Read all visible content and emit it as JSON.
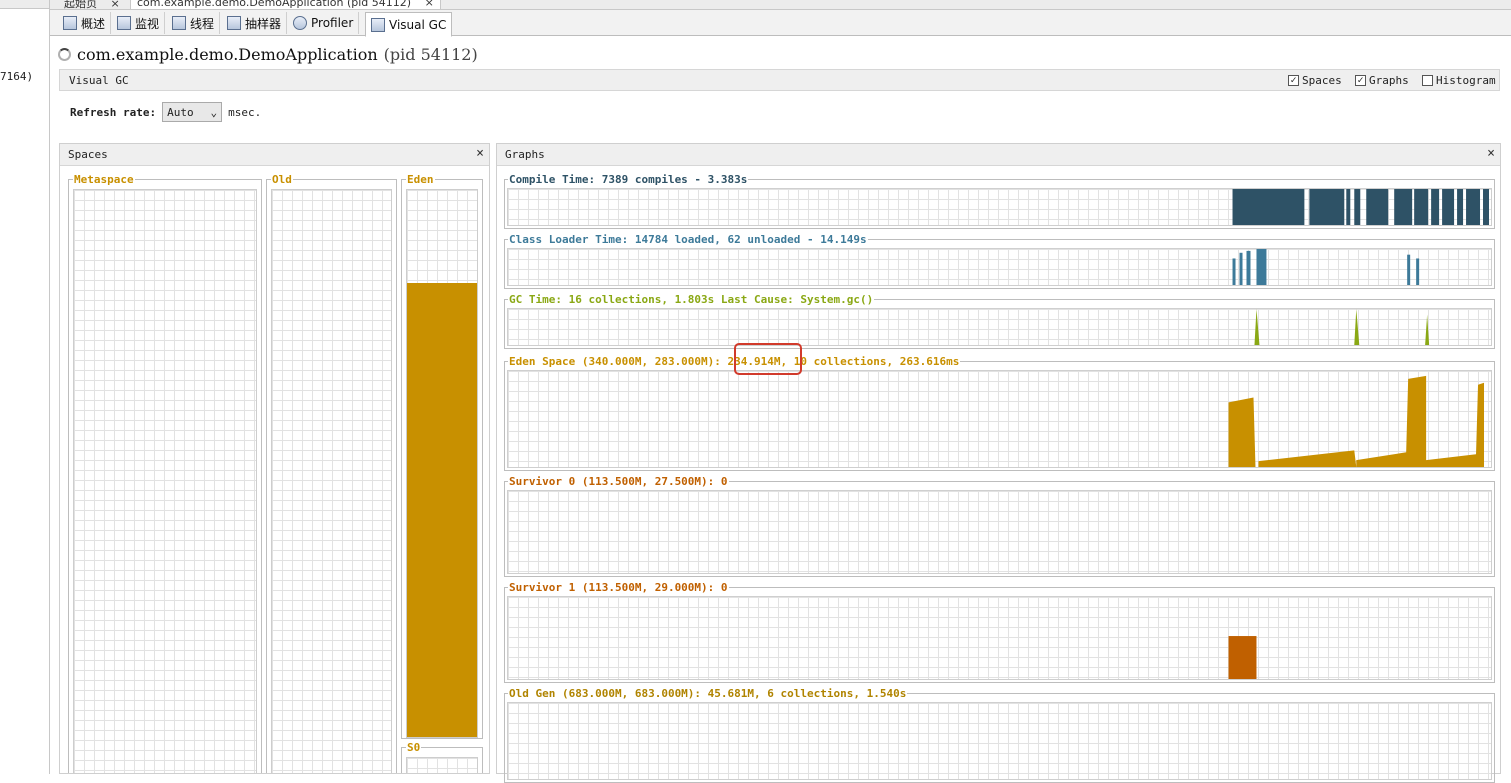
{
  "left_strip": {
    "fragment": "7164)"
  },
  "doc_tabs": [
    {
      "label": "起始页",
      "close": "×"
    },
    {
      "label": "com.example.demo.DemoApplication (pid 54112)",
      "close": "×"
    }
  ],
  "tool_tabs": [
    {
      "label": "概述",
      "icon": "info-icon"
    },
    {
      "label": "监视",
      "icon": "monitor-icon"
    },
    {
      "label": "线程",
      "icon": "threads-icon"
    },
    {
      "label": "抽样器",
      "icon": "sampler-icon"
    },
    {
      "label": "Profiler",
      "icon": "profiler-icon"
    },
    {
      "label": "Visual GC",
      "icon": "visualgc-icon",
      "active": true
    }
  ],
  "app": {
    "title": "com.example.demo.DemoApplication",
    "pid": "(pid 54112)"
  },
  "visual_gc": {
    "label": "Visual GC",
    "options": [
      {
        "label": "Spaces",
        "checked": true
      },
      {
        "label": "Graphs",
        "checked": true
      },
      {
        "label": "Histogram",
        "checked": false
      }
    ]
  },
  "refresh": {
    "label": "Refresh rate:",
    "value": "Auto",
    "unit": "msec."
  },
  "spaces_panel": {
    "title": "Spaces",
    "close": "×",
    "columns": [
      {
        "label": "Metaspace",
        "fill_fraction": 0
      },
      {
        "label": "Old",
        "fill_fraction": 0
      },
      {
        "label": "Eden",
        "fill_fraction": 0.83
      },
      {
        "label": "S0",
        "fill_fraction": 0
      }
    ]
  },
  "graphs_panel": {
    "title": "Graphs",
    "close": "×",
    "graphs": [
      {
        "title": "Compile Time: 7389 compiles - 3.383s",
        "color": "#2e5266"
      },
      {
        "title": "Class Loader Time: 14784 loaded, 62 unloaded - 14.149s",
        "color": "#3d7a99"
      },
      {
        "title": "GC Time: 16 collections, 1.803s  Last Cause: System.gc()",
        "color": "#8aa814"
      },
      {
        "title_prefix": "Eden Space (340.000M, 283.000M): ",
        "title_highlight": "234.914M,",
        "title_suffix": " 10 collections, 263.616ms",
        "color": "#c89000"
      },
      {
        "title": "Survivor 0 (113.500M, 27.500M): 0",
        "color": "#c06000"
      },
      {
        "title": "Survivor 1 (113.500M, 29.000M): 0",
        "color": "#c06000"
      },
      {
        "title": "Old Gen (683.000M, 683.000M): 45.681M, 6 collections, 1.540s",
        "color": "#b08400"
      }
    ]
  },
  "colors": {
    "eden_fill": "#c89000",
    "compile": "#2e5266",
    "classloader": "#3d7a99",
    "gc": "#8aa814",
    "survivor": "#c06000",
    "highlight": "#d13a2b"
  }
}
